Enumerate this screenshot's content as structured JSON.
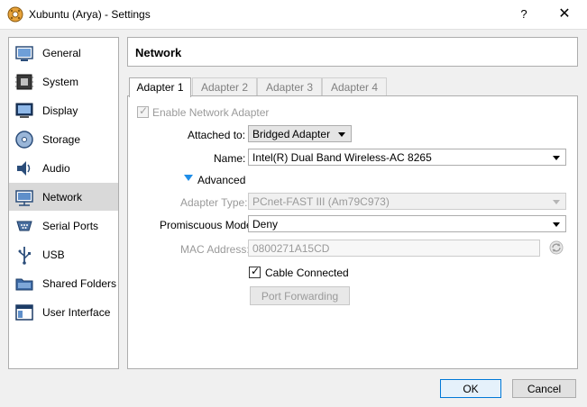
{
  "window": {
    "title": "Xubuntu (Arya) - Settings",
    "help_label": "?",
    "close_label": "✕"
  },
  "sidebar": {
    "items": [
      {
        "label": "General",
        "icon": "general-icon"
      },
      {
        "label": "System",
        "icon": "system-icon"
      },
      {
        "label": "Display",
        "icon": "display-icon"
      },
      {
        "label": "Storage",
        "icon": "storage-icon"
      },
      {
        "label": "Audio",
        "icon": "audio-icon"
      },
      {
        "label": "Network",
        "icon": "network-icon",
        "selected": true
      },
      {
        "label": "Serial Ports",
        "icon": "serial-ports-icon"
      },
      {
        "label": "USB",
        "icon": "usb-icon"
      },
      {
        "label": "Shared Folders",
        "icon": "shared-folders-icon"
      },
      {
        "label": "User Interface",
        "icon": "user-interface-icon"
      }
    ]
  },
  "header": {
    "title": "Network"
  },
  "tabs": [
    {
      "label": "Adapter 1",
      "active": true
    },
    {
      "label": "Adapter 2"
    },
    {
      "label": "Adapter 3"
    },
    {
      "label": "Adapter 4"
    }
  ],
  "adapter": {
    "enable_label": "Enable Network Adapter",
    "attached_label": "Attached to:",
    "attached_value": "Bridged Adapter",
    "name_label": "Name:",
    "name_value": "Intel(R) Dual Band Wireless-AC 8265",
    "advanced_label": "Advanced",
    "adapter_type_label": "Adapter Type:",
    "adapter_type_value": "PCnet-FAST III (Am79C973)",
    "promiscuous_label": "Promiscuous Mode:",
    "promiscuous_value": "Deny",
    "mac_label": "MAC Address:",
    "mac_value": "0800271A15CD",
    "cable_label": "Cable Connected",
    "port_forwarding_label": "Port Forwarding"
  },
  "footer": {
    "ok_label": "OK",
    "cancel_label": "Cancel"
  },
  "colors": {
    "accent": "#0078d7",
    "selected_bg": "#d9d9d9"
  }
}
